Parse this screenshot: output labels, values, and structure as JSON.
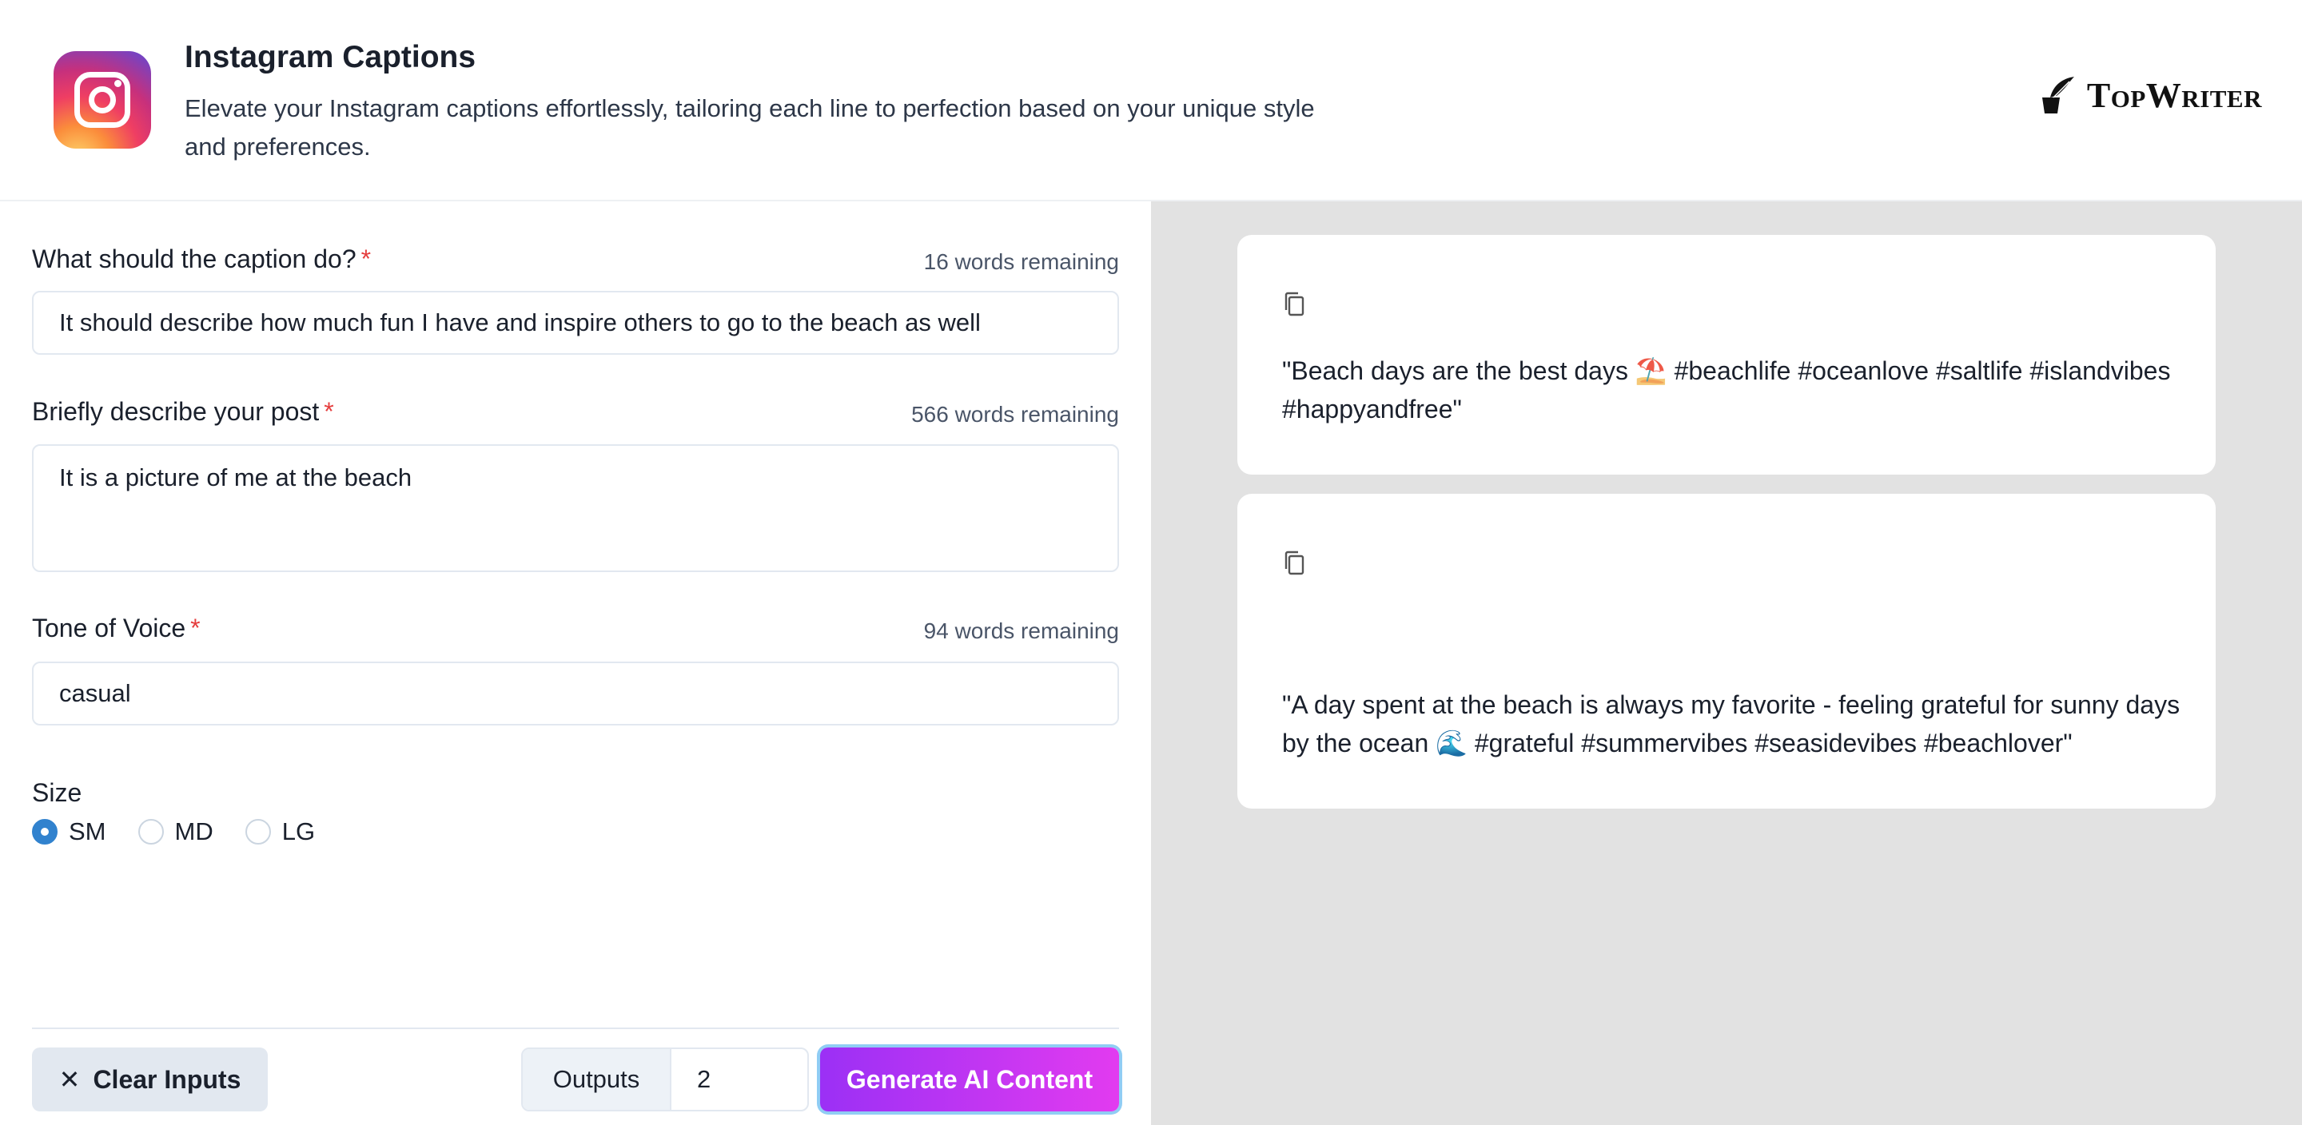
{
  "header": {
    "title": "Instagram Captions",
    "subtitle": "Elevate your Instagram captions effortlessly, tailoring each line to perfection based on your unique style and preferences.",
    "brand": "TopWriter"
  },
  "form": {
    "caption_goal": {
      "label": "What should the caption do?",
      "required_mark": "*",
      "remaining": "16 words remaining",
      "value": "It should describe how much fun I have and inspire others to go to the beach as well"
    },
    "post_description": {
      "label": "Briefly describe your post",
      "required_mark": "*",
      "remaining": "566 words remaining",
      "value": "It is a picture of me at the beach"
    },
    "tone": {
      "label": "Tone of Voice",
      "required_mark": "*",
      "remaining": "94 words remaining",
      "value": "casual"
    },
    "size": {
      "label": "Size",
      "options": [
        "SM",
        "MD",
        "LG"
      ],
      "selected": "SM"
    }
  },
  "footer": {
    "clear_label": "Clear Inputs",
    "outputs_label": "Outputs",
    "outputs_value": "2",
    "generate_label": "Generate AI Content"
  },
  "results": [
    {
      "text": "\"Beach days are the best days ⛱️ #beachlife #oceanlove #saltlife #islandvibes #happyandfree\""
    },
    {
      "text": "\"A day spent at the beach is always my favorite - feeling grateful for sunny days by the ocean 🌊 #grateful #summervibes #seasidevibes #beachlover\""
    }
  ]
}
